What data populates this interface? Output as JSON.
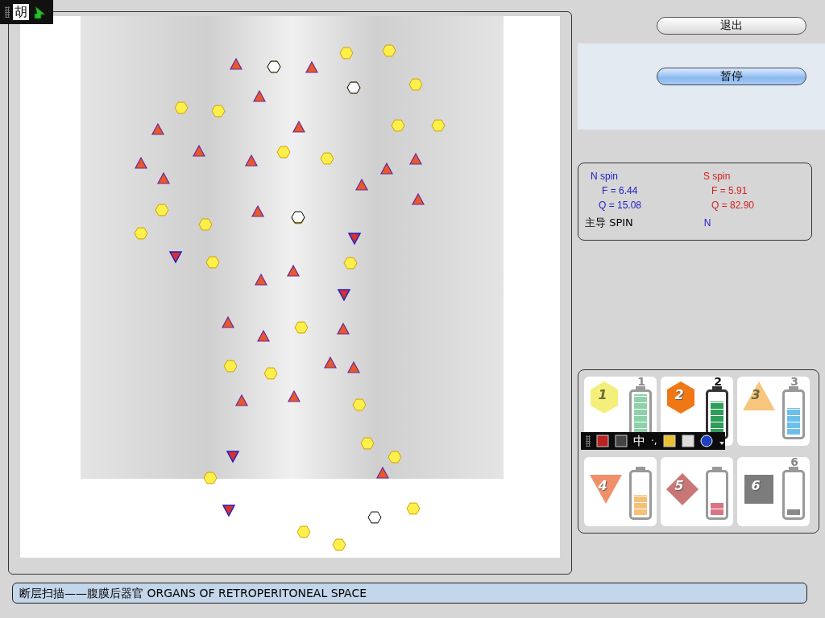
{
  "ime_status": {
    "char": "胡"
  },
  "buttons": [
    {
      "label": "退出",
      "selected": false
    },
    {
      "label": "暂停",
      "selected": true
    }
  ],
  "spin": {
    "n": {
      "title": "N spin",
      "f": "F =  6.44",
      "q": "Q = 15.08"
    },
    "s": {
      "title": "S spin",
      "f": "F =  5.91",
      "q": "Q = 82.90"
    },
    "dominant_label": "主导 SPIN",
    "dominant_value": "N"
  },
  "legend": [
    {
      "kind": "hexagon",
      "color": "#f3ef7a",
      "marker_label": "1",
      "battery_label": "1",
      "battery": {
        "level": 1,
        "color": "#8fd1a8"
      },
      "selected": false
    },
    {
      "kind": "hexagon",
      "color": "#f07814",
      "marker_label": "2",
      "battery_label": "2",
      "battery": {
        "level": 0.83,
        "color": "#2e9e5a"
      },
      "selected": true
    },
    {
      "kind": "triangle",
      "color": "#f7c57c",
      "marker_label": "3",
      "battery_label": "3",
      "battery": {
        "level": 0.67,
        "color": "#6cc0e8"
      },
      "selected": false
    },
    {
      "kind": "down-triangle",
      "color": "#f0906a",
      "marker_label": "4",
      "battery": {
        "level": 0.5,
        "color": "#f7c077"
      },
      "selected": false
    },
    {
      "kind": "diamond",
      "color": "#c97676",
      "marker_label": "5",
      "battery": {
        "level": 0.33,
        "color": "#da7484"
      },
      "selected": false
    },
    {
      "kind": "square",
      "color": "#7c7c7c",
      "marker_label": "6",
      "battery_label": "6",
      "battery": {
        "level": 0.17,
        "color": "#8a8a8a"
      },
      "selected": false
    }
  ],
  "ime_toolbar": {
    "mode": "中",
    "punct": "·,"
  },
  "status_bar": "断层扫描——腹膜后器官 ORGANS OF RETROPERITONEAL SPACE"
}
